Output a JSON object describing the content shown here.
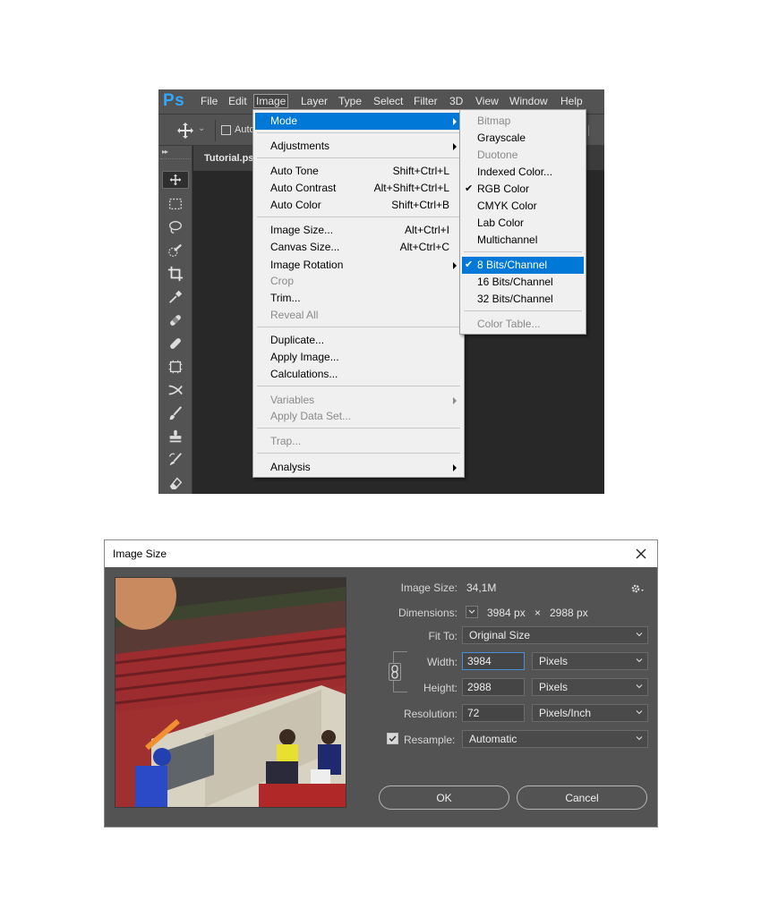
{
  "photoshop": {
    "logo": "Ps",
    "menus": [
      "File",
      "Edit",
      "Image",
      "Layer",
      "Type",
      "Select",
      "Filter",
      "3D",
      "View",
      "Window",
      "Help"
    ],
    "options_bar": {
      "auto_select_label": "Auto"
    },
    "document_tab": "Tutorial.psd",
    "image_menu": {
      "items": [
        {
          "label": "Mode",
          "shortcut": "",
          "submenu": true,
          "disabled": false,
          "highlighted": true
        },
        {
          "label": "Adjustments",
          "shortcut": "",
          "submenu": true,
          "disabled": false
        },
        {
          "label": "Auto Tone",
          "shortcut": "Shift+Ctrl+L",
          "disabled": false
        },
        {
          "label": "Auto Contrast",
          "shortcut": "Alt+Shift+Ctrl+L",
          "disabled": false
        },
        {
          "label": "Auto Color",
          "shortcut": "Shift+Ctrl+B",
          "disabled": false
        },
        {
          "label": "Image Size...",
          "shortcut": "Alt+Ctrl+I",
          "disabled": false
        },
        {
          "label": "Canvas Size...",
          "shortcut": "Alt+Ctrl+C",
          "disabled": false
        },
        {
          "label": "Image Rotation",
          "shortcut": "",
          "submenu": true,
          "disabled": false
        },
        {
          "label": "Crop",
          "shortcut": "",
          "disabled": true
        },
        {
          "label": "Trim...",
          "shortcut": "",
          "disabled": false
        },
        {
          "label": "Reveal All",
          "shortcut": "",
          "disabled": true
        },
        {
          "label": "Duplicate...",
          "shortcut": "",
          "disabled": false
        },
        {
          "label": "Apply Image...",
          "shortcut": "",
          "disabled": false
        },
        {
          "label": "Calculations...",
          "shortcut": "",
          "disabled": false
        },
        {
          "label": "Variables",
          "shortcut": "",
          "submenu": true,
          "disabled": true
        },
        {
          "label": "Apply Data Set...",
          "shortcut": "",
          "disabled": true
        },
        {
          "label": "Trap...",
          "shortcut": "",
          "disabled": true
        },
        {
          "label": "Analysis",
          "shortcut": "",
          "submenu": true,
          "disabled": false
        }
      ]
    },
    "mode_submenu": {
      "items": [
        {
          "label": "Bitmap",
          "disabled": true
        },
        {
          "label": "Grayscale",
          "disabled": false
        },
        {
          "label": "Duotone",
          "disabled": true
        },
        {
          "label": "Indexed Color...",
          "disabled": false
        },
        {
          "label": "RGB Color",
          "checked": true,
          "disabled": false
        },
        {
          "label": "CMYK Color",
          "disabled": false
        },
        {
          "label": "Lab Color",
          "disabled": false
        },
        {
          "label": "Multichannel",
          "disabled": false
        },
        {
          "label": "8 Bits/Channel",
          "checked": true,
          "highlighted": true,
          "disabled": false
        },
        {
          "label": "16 Bits/Channel",
          "disabled": false
        },
        {
          "label": "32 Bits/Channel",
          "disabled": false
        },
        {
          "label": "Color Table...",
          "disabled": true
        }
      ]
    }
  },
  "dialog": {
    "title": "Image Size",
    "image_size_label": "Image Size:",
    "image_size_value": "34,1M",
    "dimensions_label": "Dimensions:",
    "dimensions_width": "3984 px",
    "dimensions_x": "×",
    "dimensions_height": "2988 px",
    "fit_to_label": "Fit To:",
    "fit_to_value": "Original Size",
    "width_label": "Width:",
    "width_value": "3984",
    "width_unit": "Pixels",
    "height_label": "Height:",
    "height_value": "2988",
    "height_unit": "Pixels",
    "resolution_label": "Resolution:",
    "resolution_value": "72",
    "resolution_unit": "Pixels/Inch",
    "resample_label": "Resample:",
    "resample_checked": true,
    "resample_value": "Automatic",
    "ok_label": "OK",
    "cancel_label": "Cancel"
  },
  "colors": {
    "highlight": "#0078d7",
    "ps_blue": "#31a8ff",
    "panel": "#535353"
  }
}
